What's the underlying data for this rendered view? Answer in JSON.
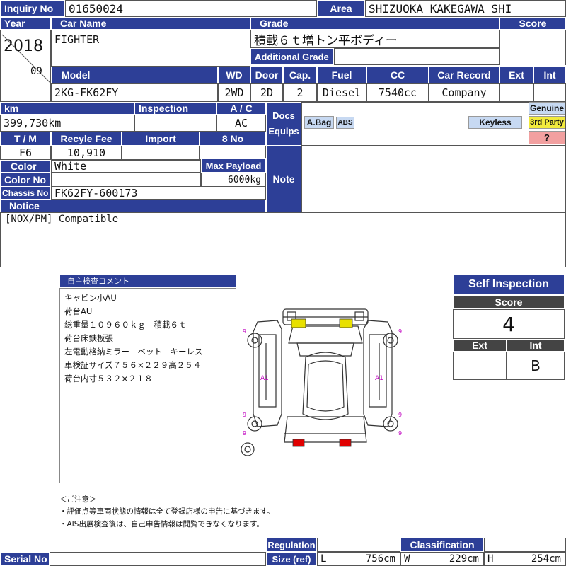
{
  "header": {
    "inquiry_label": "Inquiry No",
    "inquiry_value": "01650024",
    "area_label": "Area",
    "area_value": "SHIZUOKA KAKEGAWA SHI"
  },
  "row2": {
    "year_label": "Year",
    "year_value": "2018",
    "month_value": "09",
    "car_name_label": "Car Name",
    "car_name_value": "FIGHTER",
    "grade_label": "Grade",
    "grade_value": "積載６ｔ増トン平ボディー",
    "additional_grade_label": "Additional Grade",
    "additional_grade_value": "",
    "score_label": "Score",
    "score_value": ""
  },
  "model_row": {
    "labels": {
      "model": "Model",
      "wd": "WD",
      "door": "Door",
      "cap": "Cap.",
      "fuel": "Fuel",
      "cc": "CC",
      "car_record": "Car Record",
      "ext": "Ext",
      "int": "Int"
    },
    "values": {
      "model": "2KG-FK62FY",
      "wd": "2WD",
      "door": "2D",
      "cap": "2",
      "fuel": "Diesel",
      "cc": "7540cc",
      "car_record": "Company",
      "ext": "",
      "int": ""
    }
  },
  "details": {
    "km_label": "km",
    "km_value": "399,730km",
    "inspection_label": "Inspection",
    "inspection_value": "",
    "ac_label": "A / C",
    "ac_value": "AC",
    "tm_label": "T / M",
    "tm_value": "F6",
    "recycle_label": "Recyle Fee",
    "recycle_value": "10,910",
    "import_label": "Import",
    "import_value": "",
    "no8_label": "8 No",
    "no8_value": "",
    "color_label": "Color",
    "color_value": "White",
    "max_payload_label": "Max Payload",
    "max_payload_value": "6000kg",
    "color_no_label": "Color No",
    "color_no_value": "",
    "chassis_label": "Chassis No",
    "chassis_value": "FK62FY-600173",
    "notice_label": "Notice",
    "notice_value": "[NOX/PM] Compatible"
  },
  "docs": {
    "label_line1": "Docs",
    "label_line2": "Equips",
    "abag": "A.Bag",
    "abs": "ABS",
    "keyless": "Keyless",
    "genuine": "Genuine",
    "third_party": "3rd Party",
    "unknown": "?",
    "note_label": "Note"
  },
  "comment": {
    "title": "自主検査コメント",
    "lines": [
      "キャビン小AU",
      "荷台AU",
      "総重量１０９６０ｋｇ　積載６ｔ",
      "荷台床鉄板張",
      "左電動格納ミラー　ベット　キーレス",
      "車検証サイズ７５６×２２９高２５４",
      "荷台内寸５３２×２１８"
    ]
  },
  "diagram": {
    "marks": {
      "a1_left": "A1",
      "a1_right": "A1",
      "wheel_mark": "9"
    },
    "colors": {
      "yellow": "#e8e000",
      "red": "#e00000",
      "mark": "#c000c0"
    }
  },
  "self_inspection": {
    "title": "Self Inspection",
    "score_label": "Score",
    "score_value": "4",
    "ext_label": "Ext",
    "ext_value": "",
    "int_label": "Int",
    "int_value": "B"
  },
  "notices": {
    "heading": "＜ご注意＞",
    "line1": "・評価点等車両状態の情報は全て登録店様の申告に基づきます。",
    "line2": "・AIS出展検査後は、自己申告情報は閲覧できなくなります。"
  },
  "footer": {
    "serial_label": "Serial No",
    "serial_value": "",
    "regulation_label": "Regulation",
    "size_label": "Size (ref)",
    "classification_label": "Classification",
    "classification_value": "",
    "l_label": "L",
    "l_value": "756cm",
    "w_label": "W",
    "w_value": "229cm",
    "h_label": "H",
    "h_value": "254cm"
  },
  "theme": {
    "header_blue": "#2d3f97",
    "keyless_blue": "#c7d9f2",
    "third_party_yellow": "#f2ea3d",
    "unknown_pink": "#f2a0a0"
  }
}
